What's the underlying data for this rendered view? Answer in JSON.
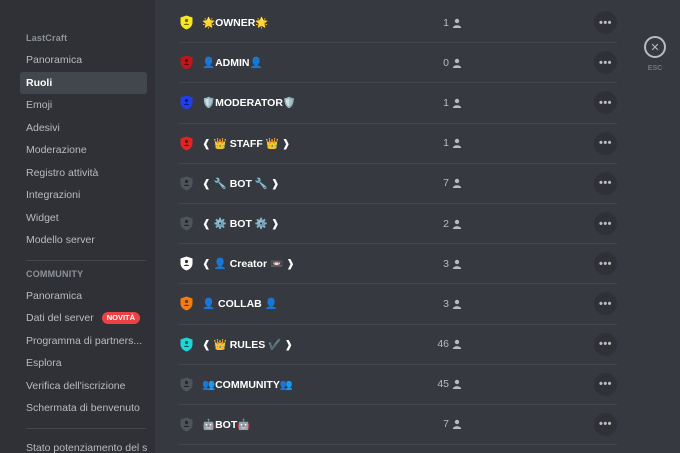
{
  "sidebar": {
    "server_name": "LastCraft",
    "items": [
      {
        "label": "Panoramica",
        "active": false
      },
      {
        "label": "Ruoli",
        "active": true
      },
      {
        "label": "Emoji",
        "active": false
      },
      {
        "label": "Adesivi",
        "active": false
      },
      {
        "label": "Moderazione",
        "active": false
      },
      {
        "label": "Registro attività",
        "active": false
      },
      {
        "label": "Integrazioni",
        "active": false
      },
      {
        "label": "Widget",
        "active": false
      },
      {
        "label": "Modello server",
        "active": false
      }
    ],
    "community_header": "COMMUNITY",
    "community_items": [
      {
        "label": "Panoramica"
      },
      {
        "label": "Dati del server",
        "badge": "NOVITÀ"
      },
      {
        "label": "Programma di partners..."
      },
      {
        "label": "Esplora"
      },
      {
        "label": "Verifica dell'iscrizione"
      },
      {
        "label": "Schermata di benvenuto"
      }
    ],
    "boost_item": "Stato potenziamento del se"
  },
  "roles": [
    {
      "name": "🌟OWNER🌟",
      "count": "1",
      "color": "#f8e71c"
    },
    {
      "name": "👤ADMIN👤",
      "count": "0",
      "color": "#c0151b"
    },
    {
      "name": "🛡️MODERATOR🛡️",
      "count": "1",
      "color": "#1f3ff0"
    },
    {
      "name": "❰ 👑 STAFF 👑 ❱",
      "count": "1",
      "color": "#e02424"
    },
    {
      "name": "❰ 🔧 BOT 🔧 ❱",
      "count": "7",
      "color": "#4f545c"
    },
    {
      "name": "❰ ⚙️ BOT ⚙️ ❱",
      "count": "2",
      "color": "#4f545c"
    },
    {
      "name": "❰ 👤 Creator 📼 ❱",
      "count": "3",
      "color": "#ffffff"
    },
    {
      "name": "👤 COLLAB 👤",
      "count": "3",
      "color": "#f57c12"
    },
    {
      "name": "❰ 👑 RULES ✔️ ❱",
      "count": "46",
      "color": "#1ed6d6"
    },
    {
      "name": "👥COMMUNITY👥",
      "count": "45",
      "color": "#4f545c"
    },
    {
      "name": "🤖BOT🤖",
      "count": "7",
      "color": "#4f545c"
    }
  ],
  "more_label": "•••",
  "close": {
    "glyph": "✕",
    "label": "ESC"
  },
  "icons": {
    "shield": "shield-icon",
    "person": "person-icon",
    "more": "more-icon",
    "close": "close-icon"
  }
}
